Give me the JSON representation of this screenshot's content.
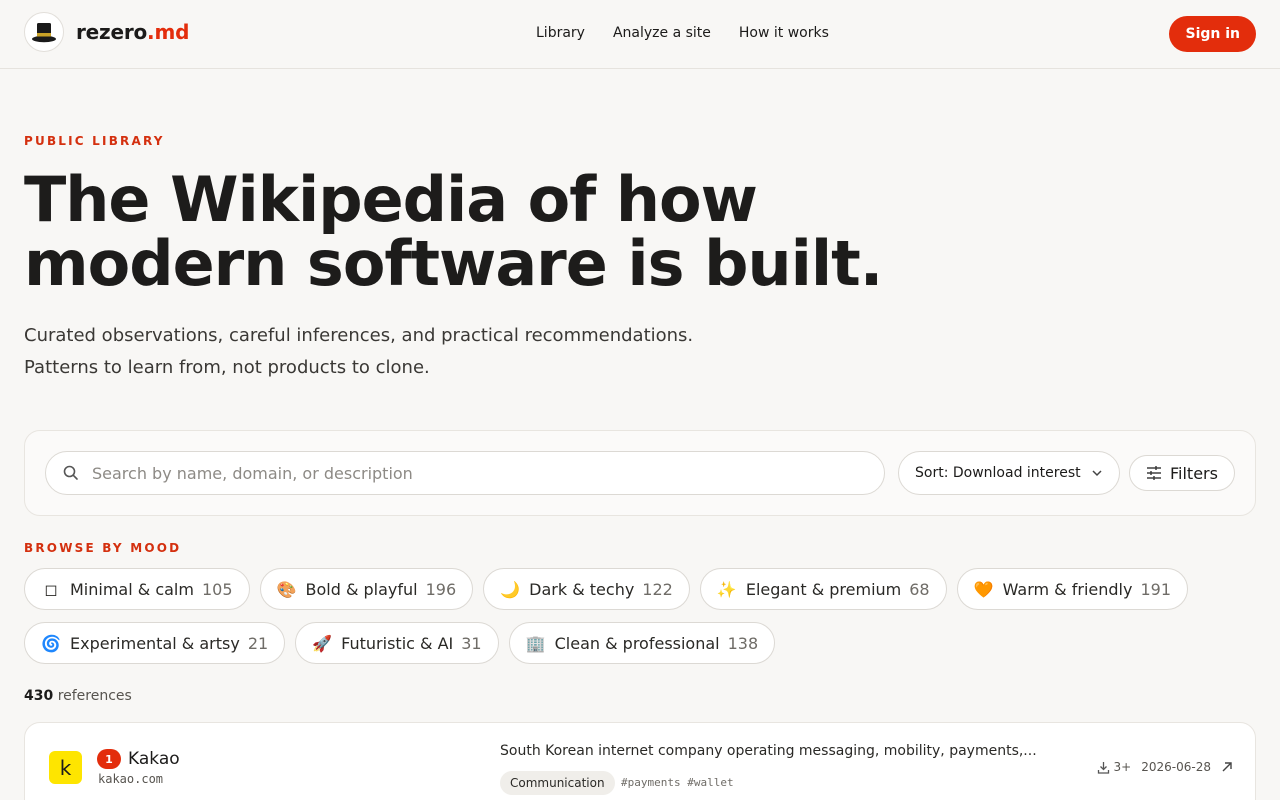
{
  "brand": {
    "name": "rezero",
    "suffix": ".md"
  },
  "nav": {
    "library": "Library",
    "analyze": "Analyze a site",
    "how": "How it works"
  },
  "header": {
    "signin": "Sign in"
  },
  "hero": {
    "kicker": "PUBLIC LIBRARY",
    "headline_line1": "The Wikipedia of how",
    "headline_line2": "modern software is built.",
    "sub_line1": "Curated observations, careful inferences, and practical recommendations.",
    "sub_line2": "Patterns to learn from, not products to clone."
  },
  "search": {
    "placeholder": "Search by name, domain, or description",
    "value": "",
    "sort_label": "Sort: Download interest",
    "filters_label": "Filters"
  },
  "moods": {
    "kicker": "BROWSE BY MOOD",
    "items": [
      {
        "emoji": "◻",
        "label": "Minimal & calm",
        "count": "105"
      },
      {
        "emoji": "🎨",
        "label": "Bold & playful",
        "count": "196"
      },
      {
        "emoji": "🌙",
        "label": "Dark & techy",
        "count": "122"
      },
      {
        "emoji": "✨",
        "label": "Elegant & premium",
        "count": "68"
      },
      {
        "emoji": "🧡",
        "label": "Warm & friendly",
        "count": "191"
      },
      {
        "emoji": "🌀",
        "label": "Experimental & artsy",
        "count": "21"
      },
      {
        "emoji": "🚀",
        "label": "Futuristic & AI",
        "count": "31"
      },
      {
        "emoji": "🏢",
        "label": "Clean & professional",
        "count": "138"
      }
    ]
  },
  "refs": {
    "count": "430",
    "label": "references"
  },
  "cards": [
    {
      "logo_letter": "k",
      "rank": "1",
      "name": "Kakao",
      "domain": "kakao.com",
      "description": "South Korean internet company operating messaging, mobility, payments,...",
      "category": "Communication",
      "tags": "#payments #wallet",
      "downloads": "3+",
      "date": "2026-06-28"
    }
  ],
  "colors": {
    "accent": "#e32d0c",
    "kakao_yellow": "#fee500"
  }
}
